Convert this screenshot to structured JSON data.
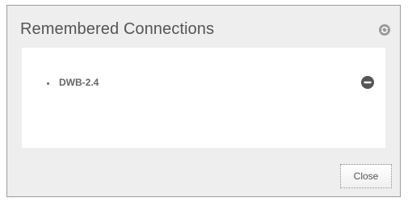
{
  "dialog": {
    "title": "Remembered Connections",
    "refresh_icon": "refresh-icon"
  },
  "connections": [
    {
      "name": "DWB-2.4",
      "remove_icon": "minus-circle-icon"
    }
  ],
  "footer": {
    "close_label": "Close"
  }
}
